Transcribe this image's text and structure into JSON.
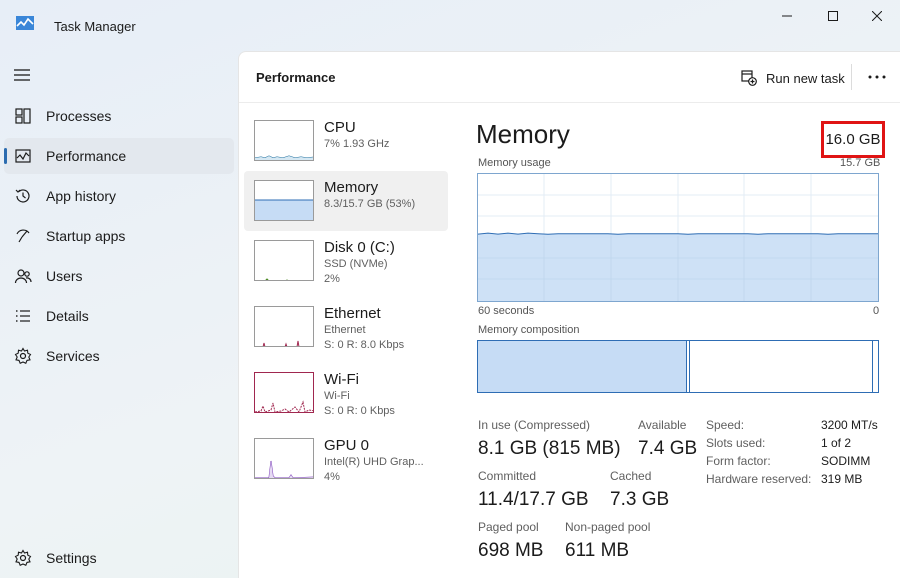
{
  "window": {
    "title": "Task Manager",
    "controls": [
      "minimize",
      "maximize",
      "close"
    ]
  },
  "sidebar": {
    "menu_icon": "hamburger-icon",
    "items": [
      {
        "label": "Processes",
        "icon": "processes-icon",
        "active": false
      },
      {
        "label": "Performance",
        "icon": "performance-icon",
        "active": true
      },
      {
        "label": "App history",
        "icon": "history-icon",
        "active": false
      },
      {
        "label": "Startup apps",
        "icon": "startup-icon",
        "active": false
      },
      {
        "label": "Users",
        "icon": "users-icon",
        "active": false
      },
      {
        "label": "Details",
        "icon": "details-icon",
        "active": false
      },
      {
        "label": "Services",
        "icon": "services-icon",
        "active": false
      }
    ],
    "settings": {
      "label": "Settings",
      "icon": "gear-icon"
    }
  },
  "header": {
    "title": "Performance",
    "run_new_task": "Run new task",
    "more_icon": "more-icon"
  },
  "devices": [
    {
      "name": "CPU",
      "sub1": "7%  1.93 GHz",
      "sub2": "",
      "sub3": "",
      "color": "#1f6f9e",
      "active": false
    },
    {
      "name": "Memory",
      "sub1": "8.3/15.7 GB (53%)",
      "sub2": "",
      "sub3": "",
      "color": "#2e6db4",
      "active": true
    },
    {
      "name": "Disk 0 (C:)",
      "sub1": "SSD (NVMe)",
      "sub2": "2%",
      "sub3": "",
      "color": "#4a8a1f",
      "active": false
    },
    {
      "name": "Ethernet",
      "sub1": "Ethernet",
      "sub2": "S: 0  R: 8.0 Kbps",
      "sub3": "",
      "color": "#a0274f",
      "active": false
    },
    {
      "name": "Wi-Fi",
      "sub1": "Wi-Fi",
      "sub2": "S: 0  R: 0 Kbps",
      "sub3": "",
      "color": "#a0274f",
      "active": false
    },
    {
      "name": "GPU 0",
      "sub1": "Intel(R) UHD Grap...",
      "sub2": "4%",
      "sub3": "",
      "color": "#7a3cb8",
      "active": false
    }
  ],
  "memory": {
    "title": "Memory",
    "total": "16.0 GB",
    "usage_label": "Memory usage",
    "usage_max": "15.7 GB",
    "time_label": "60 seconds",
    "time_end": "0",
    "composition_label": "Memory composition",
    "usage_fraction": 0.53,
    "stats": {
      "in_use_label": "In use (Compressed)",
      "in_use": "8.1 GB (815 MB)",
      "available_label": "Available",
      "available": "7.4 GB",
      "committed_label": "Committed",
      "committed": "11.4/17.7 GB",
      "cached_label": "Cached",
      "cached": "7.3 GB",
      "paged_label": "Paged pool",
      "paged": "698 MB",
      "nonpaged_label": "Non-paged pool",
      "nonpaged": "611 MB"
    },
    "specs": [
      {
        "key": "Speed:",
        "value": "3200 MT/s"
      },
      {
        "key": "Slots used:",
        "value": "1 of 2"
      },
      {
        "key": "Form factor:",
        "value": "SODIMM"
      },
      {
        "key": "Hardware reserved:",
        "value": "319 MB"
      }
    ]
  },
  "colors": {
    "accent": "#2b6cb0",
    "memory_fill": "#c6dcf5",
    "memory_line": "#2e6db4",
    "highlight_box": "#e01414"
  }
}
